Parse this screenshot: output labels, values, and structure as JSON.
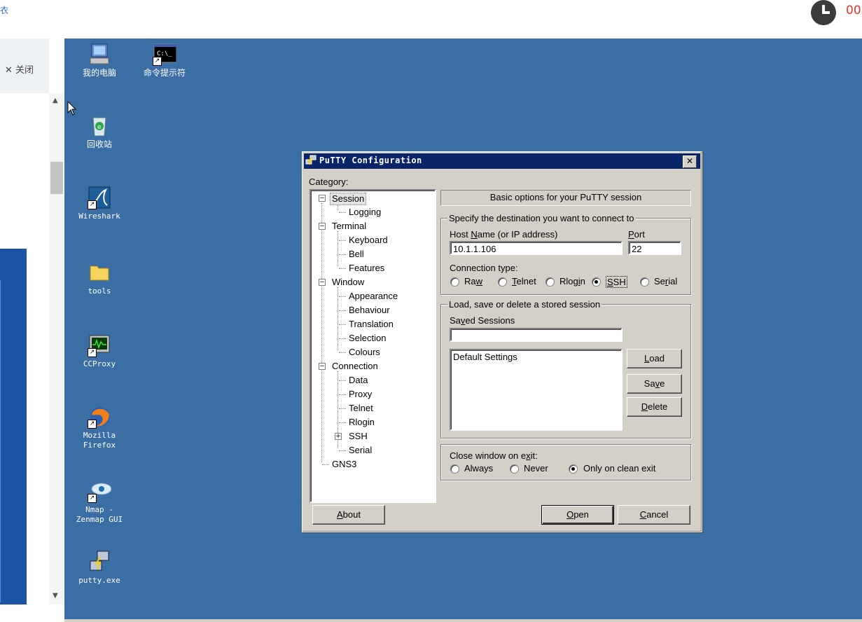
{
  "topbar": {
    "left_text": "衣",
    "timer": "00"
  },
  "leftpanel": {
    "close_label": "✕ 关闭"
  },
  "desktop": {
    "icons": [
      {
        "label": "我的电脑",
        "icon": "my-computer-icon"
      },
      {
        "label": "命令提示符",
        "icon": "command-prompt-icon"
      },
      {
        "label": "回收站",
        "icon": "recycle-bin-icon"
      },
      {
        "label": "Wireshark",
        "icon": "wireshark-icon"
      },
      {
        "label": "tools",
        "icon": "folder-icon"
      },
      {
        "label": "CCProxy",
        "icon": "ccproxy-icon"
      },
      {
        "label": "Mozilla\nFirefox",
        "icon": "firefox-icon"
      },
      {
        "label": "Nmap -\nZenmap GUI",
        "icon": "zenmap-icon"
      },
      {
        "label": "putty.exe",
        "icon": "putty-icon"
      }
    ]
  },
  "putty": {
    "title": "PuTTY Configuration",
    "category_label": "Category:",
    "tree": [
      "Session",
      "Logging",
      "Terminal",
      "Keyboard",
      "Bell",
      "Features",
      "Window",
      "Appearance",
      "Behaviour",
      "Translation",
      "Selection",
      "Colours",
      "Connection",
      "Data",
      "Proxy",
      "Telnet",
      "Rlogin",
      "SSH",
      "Serial",
      "GNS3"
    ],
    "header": "Basic options for your PuTTY session",
    "destination_group": "Specify the destination you want to connect to",
    "host_label": "Host Name (or IP address)",
    "port_label": "Port",
    "host_value": "10.1.1.106",
    "port_value": "22",
    "conn_type_label": "Connection type:",
    "conn_types": [
      "Raw",
      "Telnet",
      "Rlogin",
      "SSH",
      "Serial"
    ],
    "conn_selected": "SSH",
    "sessions_group": "Load, save or delete a stored session",
    "saved_sessions_label": "Saved Sessions",
    "saved_sessions_value": "",
    "sessions_list": [
      "Default Settings"
    ],
    "load": "Load",
    "save": "Save",
    "delete": "Delete",
    "close_exit_label": "Close window on exit:",
    "close_options": [
      "Always",
      "Never",
      "Only on clean exit"
    ],
    "close_selected": "Only on clean exit",
    "about": "About",
    "open": "Open",
    "cancel": "Cancel"
  }
}
